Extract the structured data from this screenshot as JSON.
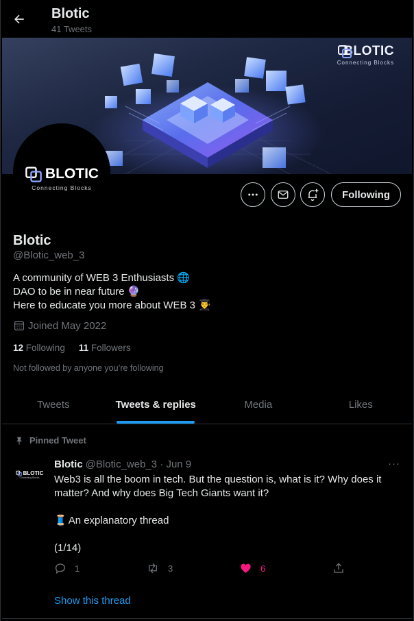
{
  "header": {
    "title": "Blotic",
    "tweet_count": "41 Tweets"
  },
  "banner": {
    "logo_text": "BLOTIC",
    "tagline": "Connecting Blocks"
  },
  "avatar": {
    "logo_text": "BLOTIC",
    "tagline": "Connecting Blocks"
  },
  "actions": {
    "more_icon": "more-icon",
    "message_icon": "mail-icon",
    "notify_icon": "bell-plus-icon",
    "follow_label": "Following"
  },
  "profile": {
    "name": "Blotic",
    "handle": "@Blotic_web_3",
    "bio": [
      {
        "text": "A community of WEB 3 Enthusiasts",
        "emoji": "🌐"
      },
      {
        "text": "DAO to be in near future",
        "emoji": "🔮"
      },
      {
        "text": "Here to educate you more about WEB 3",
        "emoji": "👨‍🎓"
      }
    ],
    "joined": "Joined May 2022",
    "following_count": "12",
    "following_label": "Following",
    "followers_count": "11",
    "followers_label": "Followers",
    "not_followed": "Not followed by anyone you’re following"
  },
  "tabs": [
    {
      "label": "Tweets",
      "active": false
    },
    {
      "label": "Tweets & replies",
      "active": true
    },
    {
      "label": "Media",
      "active": false
    },
    {
      "label": "Likes",
      "active": false
    }
  ],
  "tweet": {
    "pinned_label": "Pinned Tweet",
    "author": "Blotic",
    "handle_date": "@Blotic_web_3 · Jun 9",
    "avatar_text": "BLOTIC",
    "avatar_tag": "Connecting Blocks",
    "more": "···",
    "paragraphs": [
      "Web3 is all the boom in tech. But the question is, what is it? Why does it matter? And why does Big Tech Giants want it?",
      "An explanatory thread",
      "(1/14)"
    ],
    "thread_emoji": "🧵",
    "replies": "1",
    "retweets": "3",
    "likes": "6",
    "liked_color": "#f91880",
    "show_thread": "Show this thread"
  },
  "colors": {
    "accent": "#1d9bf0",
    "muted": "#71767b",
    "text": "#e7e9ea",
    "border": "#2f3336"
  }
}
